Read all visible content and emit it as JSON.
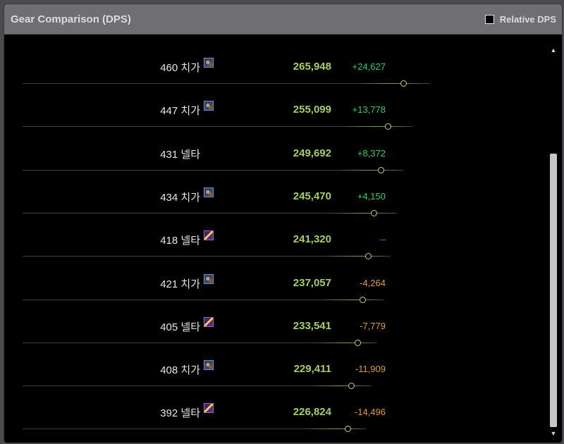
{
  "header": {
    "title": "Gear Comparison (DPS)",
    "relative_dps_label": "Relative DPS",
    "relative_dps_checked": false
  },
  "rows": [
    {
      "label": "460 치가",
      "icon": "chain-weapon-icon",
      "dps": "265,948",
      "delta": "+24,627",
      "delta_type": "pos"
    },
    {
      "label": "447 치가",
      "icon": "chain-weapon-icon",
      "dps": "255,099",
      "delta": "+13,778",
      "delta_type": "pos"
    },
    {
      "label": "431 넬타",
      "icon": "",
      "dps": "249,692",
      "delta": "+8,372",
      "delta_type": "pos"
    },
    {
      "label": "434 치가",
      "icon": "chain-weapon-icon",
      "dps": "245,470",
      "delta": "+4,150",
      "delta_type": "pos"
    },
    {
      "label": "418 넬타",
      "icon": "golden-blade-icon",
      "dps": "241,320",
      "delta": "–",
      "delta_type": "neutral"
    },
    {
      "label": "421 치가",
      "icon": "chain-weapon-icon",
      "dps": "237,057",
      "delta": "-4,264",
      "delta_type": "neg"
    },
    {
      "label": "405 넬타",
      "icon": "golden-blade-icon",
      "dps": "233,541",
      "delta": "-7,779",
      "delta_type": "neg"
    },
    {
      "label": "408 치가",
      "icon": "chain-weapon-icon",
      "dps": "229,411",
      "delta": "-11,909",
      "delta_type": "neg"
    },
    {
      "label": "392 넬타",
      "icon": "golden-blade-icon",
      "dps": "226,824",
      "delta": "-14,496",
      "delta_type": "neg"
    }
  ],
  "colors": {
    "dps": "#a5cf62",
    "positive": "#2fcf61",
    "negative": "#e39c2f",
    "neutral": "#2f8fc7"
  }
}
